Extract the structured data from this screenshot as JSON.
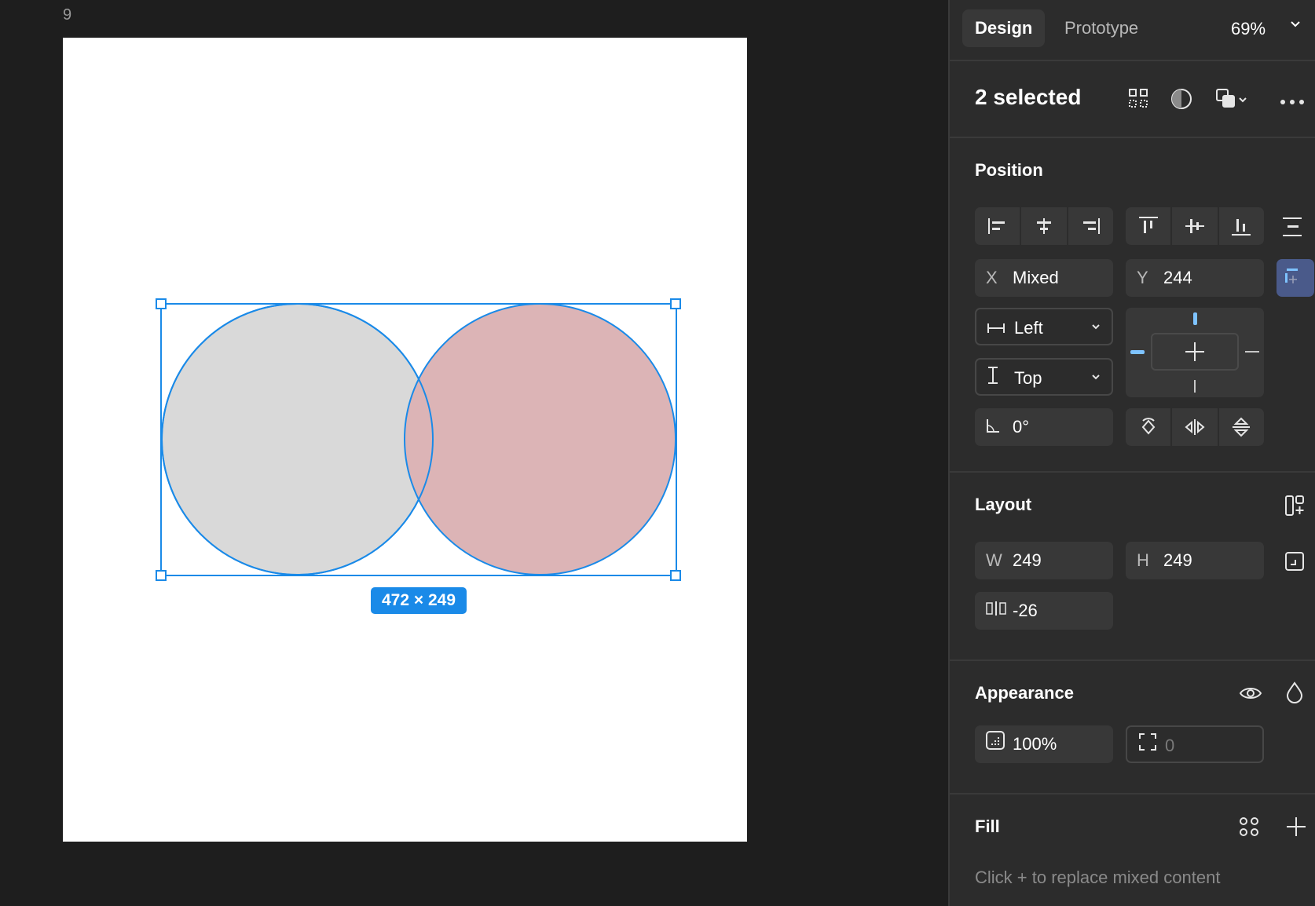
{
  "canvas": {
    "frame_label": "9",
    "size_badge": "472 × 249"
  },
  "header": {
    "tabs": [
      {
        "label": "Design",
        "active": true
      },
      {
        "label": "Prototype",
        "active": false
      }
    ],
    "zoom": "69%"
  },
  "selection": {
    "title": "2 selected"
  },
  "position": {
    "title": "Position",
    "x_label": "X",
    "x_value": "Mixed",
    "y_label": "Y",
    "y_value": "244",
    "h_constraint": "Left",
    "v_constraint": "Top",
    "rotation": "0°"
  },
  "layout": {
    "title": "Layout",
    "w_label": "W",
    "w_value": "249",
    "h_label": "H",
    "h_value": "249",
    "gap_value": "-26"
  },
  "appearance": {
    "title": "Appearance",
    "opacity": "100%",
    "radius": "0"
  },
  "fill": {
    "title": "Fill",
    "hint": "Click + to replace mixed content"
  },
  "colors": {
    "accent": "#1a8ae8",
    "left_circle": "#d9d9d9",
    "right_circle": "#dcb4b6",
    "panel_bg": "#2c2c2c",
    "canvas_bg": "#1e1e1e"
  }
}
